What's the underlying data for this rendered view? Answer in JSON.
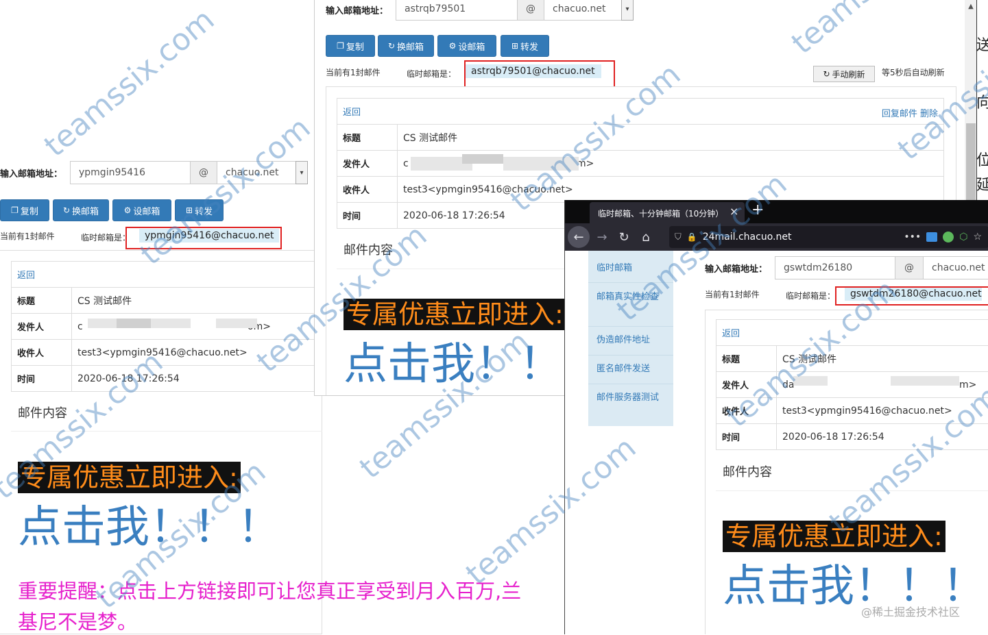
{
  "left_window": {
    "email_label": "输入邮箱地址：",
    "email_user": "ypmgin95416",
    "at": "@",
    "domain": "chacuo.net",
    "buttons": {
      "copy": "复制",
      "change": "换邮箱",
      "settings": "设邮箱",
      "forward": "转发"
    },
    "count_text": "当前有1封邮件",
    "temp_label": "临时邮箱是：",
    "temp_address": "ypmgin95416@chacuo.net",
    "back_link": "返回",
    "rows": {
      "subject_key": "标题",
      "subject_val": "CS 测试邮件",
      "from_key": "发件人",
      "from_val_start": "c",
      "from_val_end": "om>",
      "to_key": "收件人",
      "to_val": "test3<ypmgin95416@chacuo.net>",
      "time_key": "时间",
      "time_val": "2020-06-18 17:26:54"
    },
    "content_title": "邮件内容",
    "promo": "专属优惠立即进入:",
    "click_me": "点击我！！！",
    "reminder_1": "重要提醒：点击上方链接即可让您真正享受到月入百万,兰",
    "reminder_2": "基尼不是梦。"
  },
  "middle_window": {
    "email_label": "输入邮箱地址：",
    "email_user": "astrqb79501",
    "at": "@",
    "domain": "chacuo.net",
    "buttons": {
      "copy": "复制",
      "change": "换邮箱",
      "settings": "设邮箱",
      "forward": "转发"
    },
    "count_text": "当前有1封邮件",
    "temp_label": "临时邮箱是：",
    "temp_address": "astrqb79501@chacuo.net",
    "refresh_button": "手动刷新",
    "auto_refresh": "等5秒后自动刷新",
    "back_link": "返回",
    "reply_link": "回复邮件",
    "delete_link": "删除",
    "rows": {
      "subject_key": "标题",
      "subject_val": "CS 测试邮件",
      "from_key": "发件人",
      "from_val_start": "c",
      "from_val_end": "m>",
      "to_key": "收件人",
      "to_val": "test3<ypmgin95416@chacuo.net>",
      "time_key": "时间",
      "time_val": "2020-06-18 17:26:54"
    },
    "content_title": "邮件内容",
    "promo": "专属优惠立即进入:",
    "click_me": "点击我！！"
  },
  "right_window": {
    "tab_title": "临时邮箱、十分钟邮箱（10分钟）...",
    "tab_close": "×",
    "new_tab": "+",
    "url": "24mail.chacuo.net",
    "sidebar": [
      "临时邮箱",
      "邮箱真实性检查",
      "伪造邮件地址",
      "匿名邮件发送",
      "邮件服务器测试"
    ],
    "email_label": "输入邮箱地址：",
    "email_user": "gswtdm26180",
    "at": "@",
    "domain": "chacuo.net",
    "count_text": "当前有1封邮件",
    "temp_label": "临时邮箱是：",
    "temp_address": "gswtdm26180@chacuo.net",
    "back_link": "返回",
    "rows": {
      "subject_key": "标题",
      "subject_val": "CS 测试邮件",
      "from_key": "发件人",
      "from_val_start": "da",
      "from_val_end": "m>",
      "to_key": "收件人",
      "to_val": "test3<ypmgin95416@chacuo.net>",
      "time_key": "时间",
      "time_val": "2020-06-18 17:26:54"
    },
    "content_title": "邮件内容",
    "promo": "专属优惠立即进入:",
    "click_me": "点击我！！！"
  },
  "edge_fragments": [
    "送",
    "向",
    "位",
    "延"
  ],
  "watermark": "teamssix.com",
  "credit": "@稀土掘金技术社区",
  "colors": {
    "primary": "#337ab7",
    "promo_bg": "#111111",
    "promo_fg": "#ff8c1a",
    "pink": "#e620cc",
    "red_box": "#e02020"
  }
}
